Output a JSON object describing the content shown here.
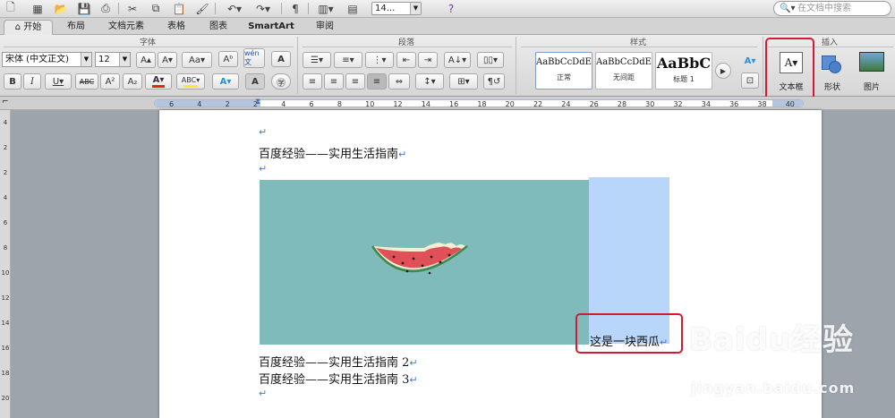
{
  "toolbar": {
    "zoom_value": "14...",
    "search_placeholder": "在文档中搜索",
    "icons": [
      "new-doc-icon",
      "gallery-icon",
      "open-icon",
      "save-icon",
      "print-icon",
      "cut-icon",
      "copy-icon",
      "paste-icon",
      "format-painter-icon",
      "undo-icon",
      "redo-icon",
      "para-marks-icon",
      "sidebar-icon",
      "gallery-view-icon",
      "media-icon",
      "help-icon",
      "search-icon"
    ]
  },
  "tabs": [
    "开始",
    "布局",
    "文档元素",
    "表格",
    "图表",
    "SmartArt",
    "审阅"
  ],
  "active_tab": "开始",
  "ribbon": {
    "groups": {
      "font": "字体",
      "paragraph": "段落",
      "styles": "样式",
      "insert": "插入"
    },
    "font_name": "宋体 (中文正文)",
    "font_size": "12",
    "styles": [
      {
        "sample": "AaBbCcDdEe",
        "name": "正常"
      },
      {
        "sample": "AaBbCcDdEe",
        "name": "无间距"
      },
      {
        "sample": "AaBbC",
        "name": "标题 1"
      }
    ],
    "insert": {
      "textbox_label": "文本框",
      "shape_label": "形状",
      "picture_label": "图片"
    },
    "colors": {
      "font_color_bar": "#e0261c",
      "highlight_bar": "#f7e83c",
      "annotation": "#d31a32"
    }
  },
  "ruler": {
    "labels": [
      "6",
      "4",
      "2",
      "2",
      "4",
      "6",
      "8",
      "10",
      "12",
      "14",
      "16",
      "18",
      "20",
      "22",
      "24",
      "26",
      "28",
      "30",
      "32",
      "34",
      "36",
      "38",
      "40"
    ]
  },
  "vruler": {
    "labels": [
      "4",
      "2",
      "2",
      "4",
      "6",
      "8",
      "10",
      "12",
      "14",
      "16",
      "18",
      "20"
    ]
  },
  "document": {
    "line1": "百度经验——实用生活指南",
    "line2": "百度经验——实用生活指南 2",
    "line3": "百度经验——实用生活指南 3",
    "para_mark": "↵",
    "textbox_text": "这是一块西瓜",
    "image_subject": "watermelon-slice",
    "colors": {
      "image_bg": "#7fbbbb",
      "textbox_bg": "#b8d6f9"
    }
  },
  "watermark": {
    "brand": "Baidu经验",
    "url": "jingyan.baidu.com"
  }
}
